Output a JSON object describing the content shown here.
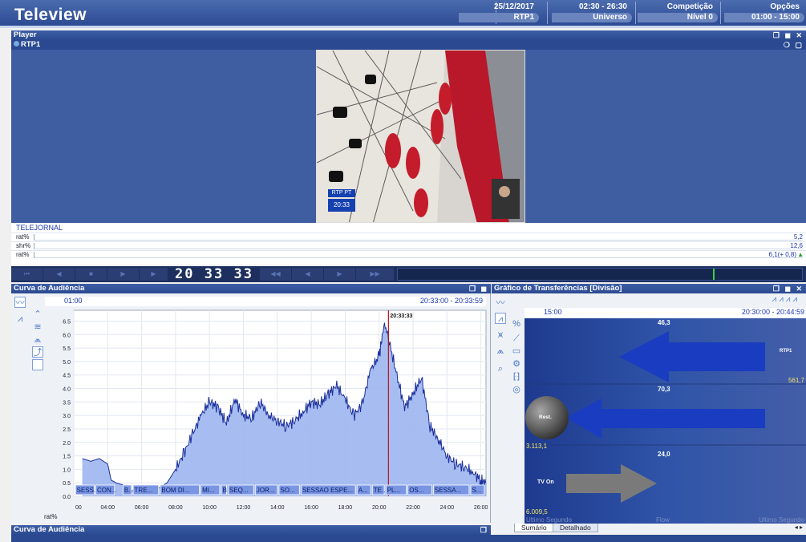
{
  "app": {
    "title": "Teleview"
  },
  "header": {
    "cells": [
      {
        "top": "25/12/2017",
        "bottom": "RTP1"
      },
      {
        "top": "02:30 - 26:30",
        "bottom": "Universo"
      },
      {
        "top": "Competição",
        "bottom": "Nível 0"
      },
      {
        "top": "Opções",
        "bottom": "01:00 - 15:00"
      }
    ]
  },
  "player": {
    "title": "Player",
    "channel": "RTP1",
    "video_tag_channel": "RTP PT",
    "video_tag_time": "20:33",
    "program": "TELEJORNAL",
    "rows": [
      {
        "label": "rat%",
        "value": "5,2"
      },
      {
        "label": "shr%",
        "value": "12,6"
      },
      {
        "label": "rat%",
        "value": "6,1(+  0,8)"
      }
    ]
  },
  "transport": {
    "clock": "20 33 33",
    "timeline_position": 0.78,
    "accent": "#3cd23c"
  },
  "curva": {
    "title": "Curva de Audiência",
    "range_start": "01:00",
    "range_label": "20:33:00 - 20:33:59",
    "footer_label": "rat%",
    "cursor_label": "20:33:33",
    "programs": [
      "SESS...",
      "CON...",
      "B...",
      "TRE...",
      "BOM DI...",
      "MI...",
      "B",
      "SEQ...",
      "JOR...",
      "SO...",
      "SESSAO ESPE...",
      "A...",
      "TE...",
      "PL...",
      "OS...",
      "SESSA...",
      "S..."
    ]
  },
  "chart_data": {
    "type": "area",
    "ylabel": "rat%",
    "ylim": [
      0,
      6.9
    ],
    "yticks": [
      "0.0",
      "0.5",
      "1.0",
      "1.5",
      "2.0",
      "2.5",
      "3.0",
      "3.5",
      "4.0",
      "4.5",
      "5.0",
      "5.5",
      "6.0",
      "6.5"
    ],
    "xticks": [
      "00",
      "04:00",
      "06:00",
      "08:00",
      "10:00",
      "12:00",
      "14:00",
      "16:00",
      "18:00",
      "20:00",
      "22:00",
      "24:00",
      "26:00"
    ],
    "x_hours": [
      2.5,
      3.0,
      3.5,
      4.0,
      4.2,
      4.5,
      5.0,
      5.5,
      6.0,
      6.5,
      7.0,
      7.5,
      8.0,
      8.5,
      9.0,
      9.5,
      10.0,
      10.5,
      11.0,
      11.5,
      12.0,
      12.5,
      13.0,
      13.5,
      14.0,
      14.5,
      15.0,
      15.5,
      16.0,
      16.5,
      17.0,
      17.5,
      18.0,
      18.5,
      19.0,
      19.5,
      20.0,
      20.3,
      20.5,
      21.0,
      21.5,
      22.0,
      22.5,
      23.0,
      23.5,
      24.0,
      24.5,
      25.0,
      25.5,
      26.0,
      26.3
    ],
    "values": [
      1.4,
      1.3,
      1.4,
      1.2,
      0.6,
      0.5,
      0.4,
      0.2,
      0.1,
      0.2,
      0.3,
      0.5,
      1.0,
      1.6,
      2.3,
      3.0,
      3.5,
      3.3,
      2.7,
      3.6,
      3.0,
      2.9,
      3.5,
      3.0,
      2.8,
      2.6,
      2.8,
      3.1,
      3.5,
      3.4,
      3.8,
      4.1,
      3.6,
      3.0,
      3.4,
      4.7,
      5.2,
      6.4,
      6.0,
      4.6,
      3.3,
      3.8,
      4.4,
      2.6,
      2.1,
      1.5,
      1.2,
      1.1,
      0.9,
      0.6,
      0.5
    ],
    "cursor_hour": 20.55,
    "grid": true
  },
  "transfer": {
    "title": "Gráfico de Transferências [Divisão]",
    "range_start": "15:00",
    "range_label": "20:30:00 - 20:44:59",
    "values": {
      "top": "46,3",
      "rtp1_label": "RTP1",
      "rtp1_total": "561,7",
      "mid": "70,3",
      "rest_label": "Rest.",
      "rest_total": "3.113,1",
      "low": "24,0",
      "tvon_label": "TV On",
      "tvon_total": "6.009,5"
    },
    "legend_left": "Ultimo Segundo",
    "legend_mid": "Flow",
    "legend_right": "Ultimo Segundo",
    "tabs": [
      "Sumário",
      "Detalhado"
    ]
  },
  "bottom": {
    "title": "Curva de Audiência"
  }
}
